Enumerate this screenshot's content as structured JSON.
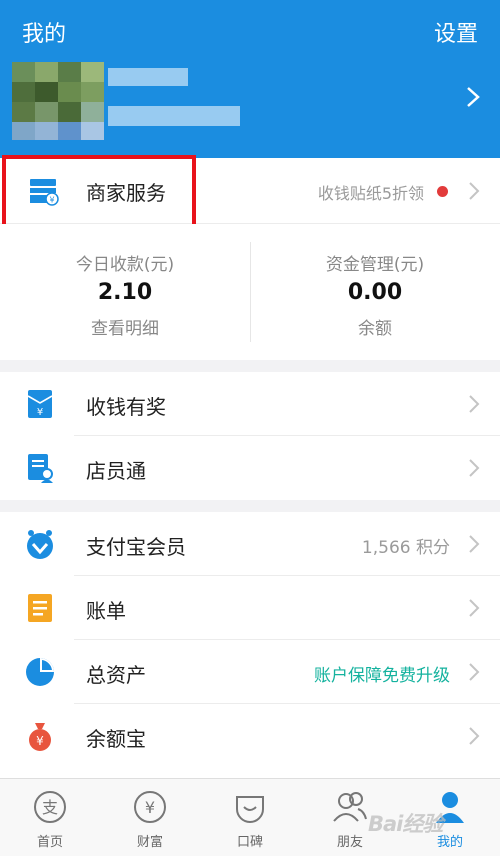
{
  "header": {
    "title": "我的",
    "settings_label": "设置"
  },
  "merchant": {
    "label": "商家服务",
    "promo": "收钱贴纸5折领"
  },
  "stats": [
    {
      "label": "今日收款(元)",
      "value": "2.10",
      "sub": "查看明细"
    },
    {
      "label": "资金管理(元)",
      "value": "0.00",
      "sub": "余额"
    }
  ],
  "group1": [
    {
      "label": "收钱有奖",
      "icon": "red-envelope-icon"
    },
    {
      "label": "店员通",
      "icon": "staff-document-icon"
    }
  ],
  "group2": [
    {
      "label": "支付宝会员",
      "extra": "1,566 积分",
      "icon": "member-badge-icon"
    },
    {
      "label": "账单",
      "icon": "bill-icon"
    },
    {
      "label": "总资产",
      "extra": "账户保障免费升级",
      "icon": "assets-pie-icon"
    },
    {
      "label": "余额宝",
      "icon": "money-bag-icon"
    }
  ],
  "tabs": [
    {
      "label": "首页",
      "icon": "alipay-home-icon"
    },
    {
      "label": "财富",
      "icon": "wealth-yuan-icon"
    },
    {
      "label": "口碑",
      "icon": "koubei-icon"
    },
    {
      "label": "朋友",
      "icon": "friends-icon"
    },
    {
      "label": "我的",
      "icon": "profile-icon"
    }
  ],
  "colors": {
    "brand": "#1b8de0",
    "highlight": "#e8121b",
    "accent_green": "#14b29e",
    "dot": "#e23b3b"
  },
  "watermark": "Bai经验"
}
